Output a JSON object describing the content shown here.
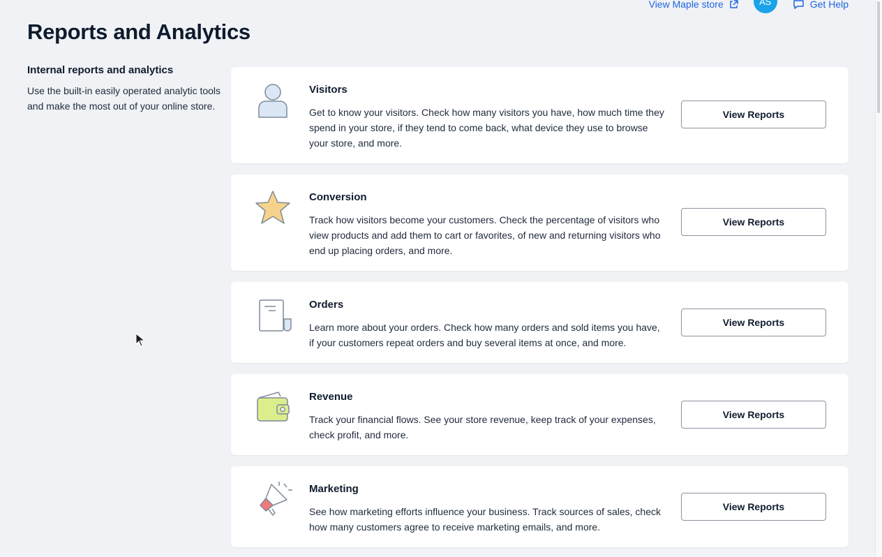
{
  "header": {
    "store_link": "View Maple store",
    "avatar_initials": "AS",
    "help_link": "Get Help"
  },
  "page": {
    "title": "Reports and Analytics"
  },
  "intro": {
    "heading": "Internal reports and analytics",
    "description": "Use the built-in easily operated analytic tools and make the most out of your online store."
  },
  "cards": [
    {
      "title": "Visitors",
      "description": "Get to know your visitors. Check how many visitors you have, how much time they spend in your store, if they tend to come back, what device they use to browse your store, and more.",
      "button": "View Reports",
      "icon": "person-icon"
    },
    {
      "title": "Conversion",
      "description": "Track how visitors become your customers. Check the percentage of visitors who view products and add them to cart or favorites, of new and returning visitors who end up placing orders, and more.",
      "button": "View Reports",
      "icon": "star-icon"
    },
    {
      "title": "Orders",
      "description": "Learn more about your orders. Check how many orders and sold items you have, if your customers repeat orders and buy several items at once, and more.",
      "button": "View Reports",
      "icon": "receipt-icon"
    },
    {
      "title": "Revenue",
      "description": "Track your financial flows. See your store revenue, keep track of your expenses, check profit, and more.",
      "button": "View Reports",
      "icon": "wallet-icon"
    },
    {
      "title": "Marketing",
      "description": "See how marketing efforts influence your business. Track sources of sales, check how many customers agree to receive marketing emails, and more.",
      "button": "View Reports",
      "icon": "megaphone-icon"
    }
  ],
  "colors": {
    "accent": "#1e66e0",
    "avatar": "#1aa3e8",
    "background": "#f0f2f5",
    "icon_blue": "#dbe7f5",
    "icon_star": "#f6d38b",
    "icon_wallet": "#dcee8c",
    "icon_megaphone": "#f0797b"
  }
}
